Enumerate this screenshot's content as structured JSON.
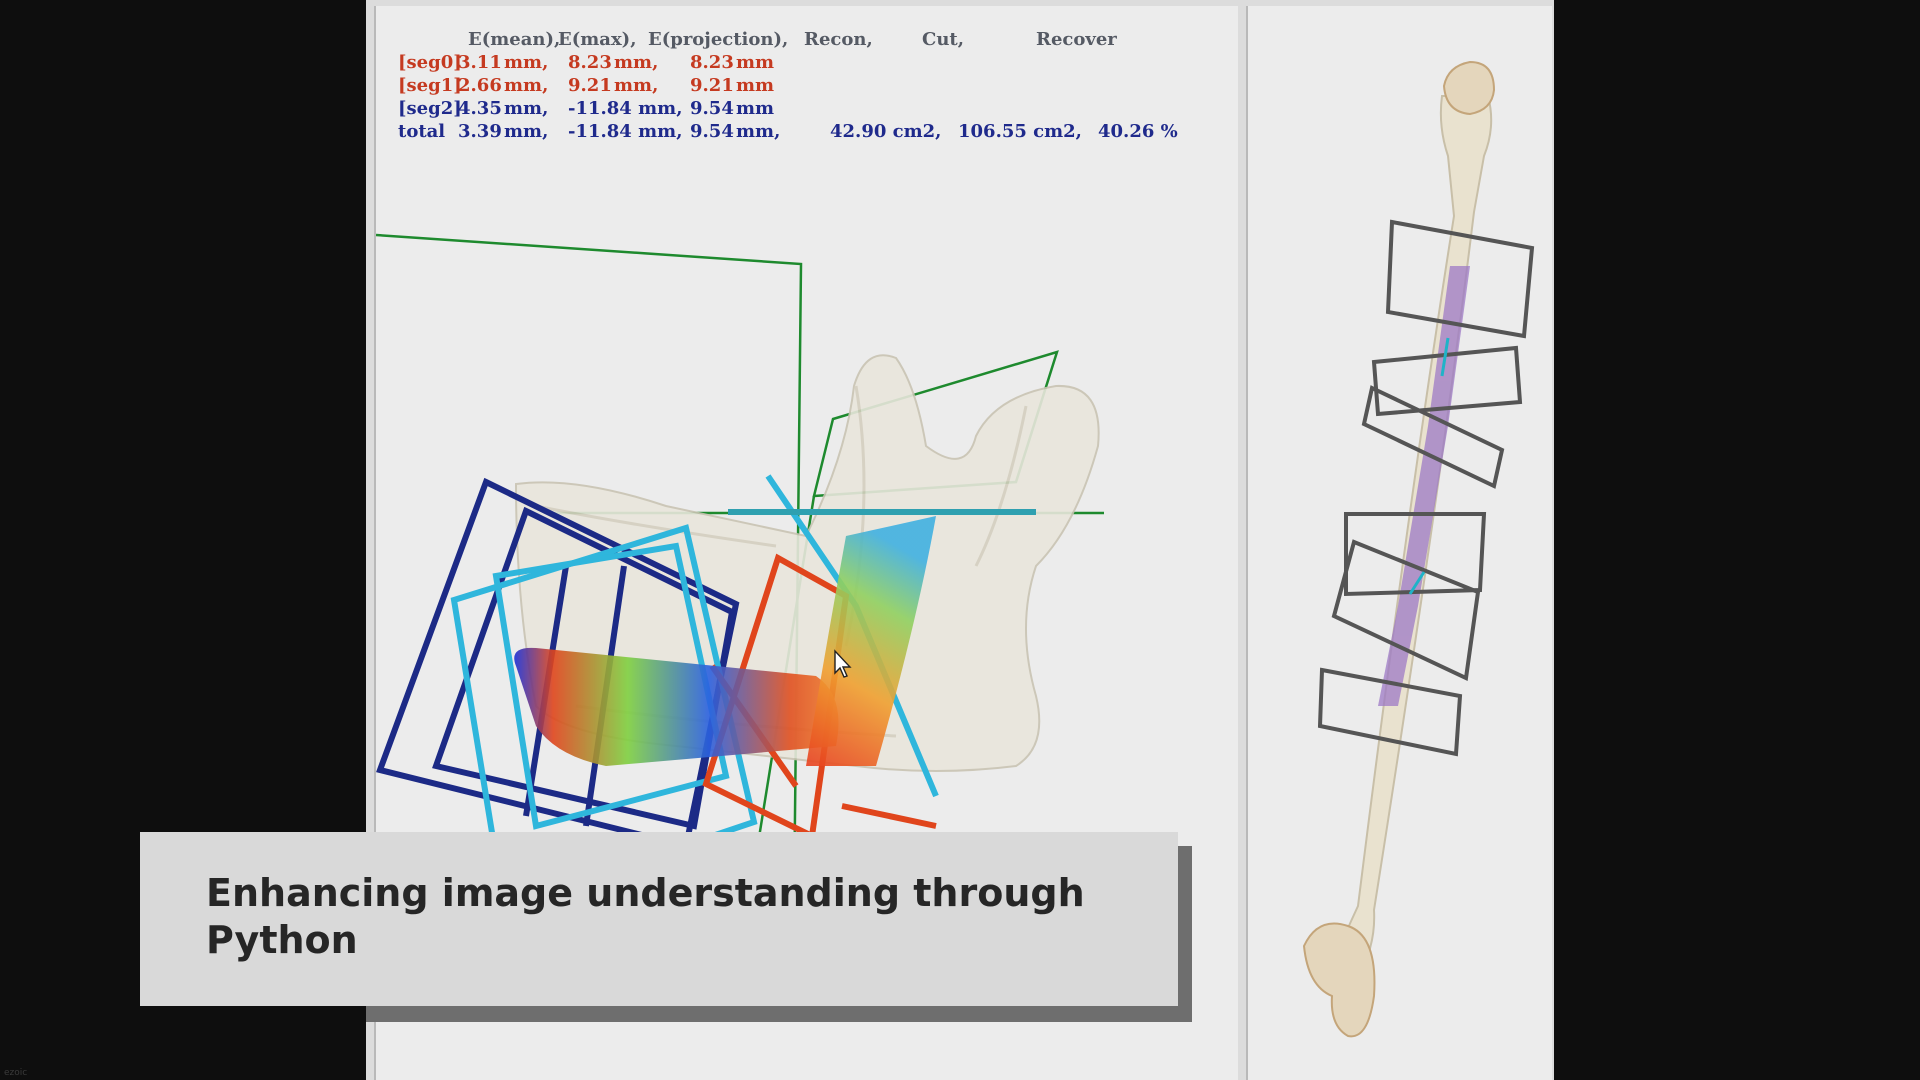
{
  "stats_table": {
    "headers": [
      "E(mean),",
      "E(max),",
      "E(projection),",
      "Recon,",
      "Cut,",
      "Recover"
    ],
    "rows": [
      {
        "label": "[seg0]",
        "cells": [
          "3.11",
          "mm,",
          "8.23",
          "mm,",
          "8.23",
          "mm",
          "",
          "",
          ""
        ]
      },
      {
        "label": "[seg1]",
        "cells": [
          "2.66",
          "mm,",
          "9.21",
          "mm,",
          "9.21",
          "mm",
          "",
          "",
          ""
        ]
      },
      {
        "label": "[seg2]",
        "cells": [
          "4.35",
          "mm,",
          "-11.84 mm,",
          "",
          "9.54",
          "mm",
          "",
          "",
          ""
        ]
      },
      {
        "label": "total",
        "cells": [
          "3.39",
          "mm,",
          "-11.84 mm,",
          "",
          "9.54",
          "mm,",
          "42.90 cm2,",
          "106.55 cm2,",
          "40.26 %"
        ]
      }
    ]
  },
  "caption": {
    "text": "Enhancing image understanding through Python"
  },
  "watermark": "ezoic",
  "colors": {
    "seg_red": "#c53a20",
    "seg_blue": "#1f2a8c",
    "plane_green": "#1e8a2e",
    "frame_navy": "#1c2a86",
    "frame_cyan": "#2fb6dc",
    "frame_orange": "#e0451c",
    "graft_purple": "#9d7ac6"
  },
  "icons": {
    "cursor": "mouse-pointer-icon"
  }
}
